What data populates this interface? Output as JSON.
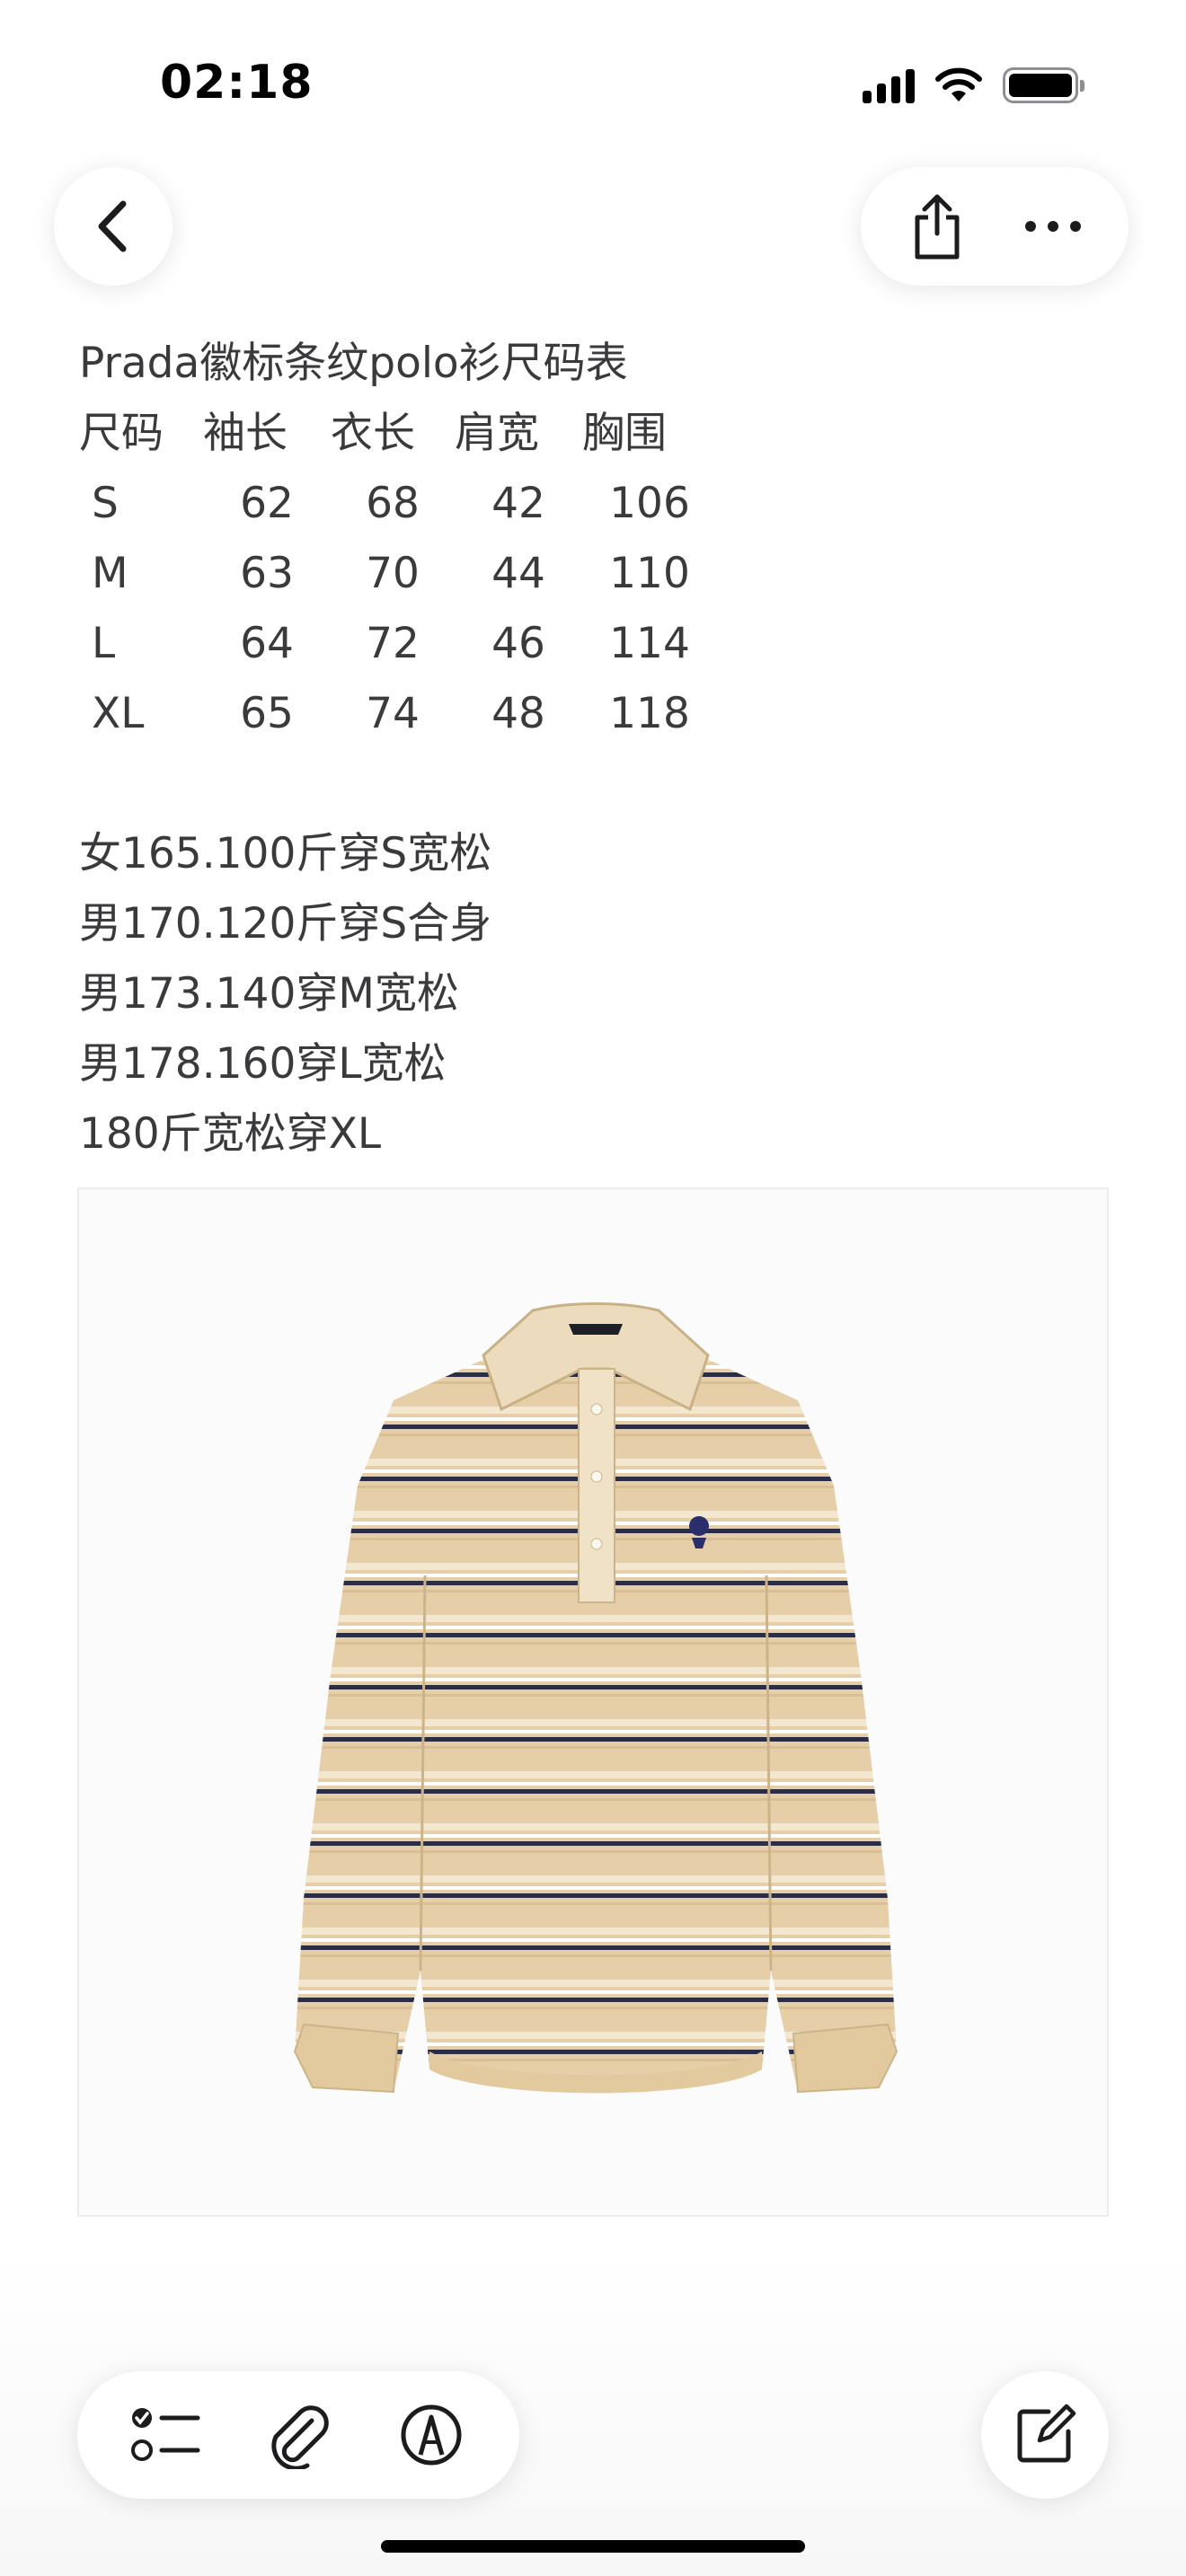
{
  "status_bar": {
    "time": "02:18"
  },
  "nav": {
    "back_icon": "chevron-left-icon",
    "share_icon": "share-icon",
    "more_icon": "ellipsis-icon"
  },
  "note": {
    "title": "Prada徽标条纹polo衫尺码表",
    "size_table": {
      "headers": [
        "尺码",
        "袖长",
        "衣长",
        "肩宽",
        "胸围"
      ],
      "rows": [
        [
          "S",
          "62",
          "68",
          "42",
          "106"
        ],
        [
          "M",
          "63",
          "70",
          "44",
          "110"
        ],
        [
          "L",
          "64",
          "72",
          "46",
          "114"
        ],
        [
          "XL",
          "65",
          "74",
          "48",
          "118"
        ]
      ]
    },
    "recommendations": [
      "女165.100斤穿S宽松",
      "男170.120斤穿S合身",
      "男173.140穿M宽松",
      "男178.160穿L宽松",
      "180斤宽松穿XL"
    ],
    "image": {
      "subject": "polo-shirt-photo",
      "colors": [
        "#e6cfa8",
        "#f3e7cf",
        "#2b2d45",
        "#ffffff"
      ]
    }
  },
  "toolbar": {
    "checklist_icon": "checklist-icon",
    "attachment_icon": "paperclip-icon",
    "markup_icon": "markup-pen-icon",
    "compose_icon": "compose-icon"
  }
}
